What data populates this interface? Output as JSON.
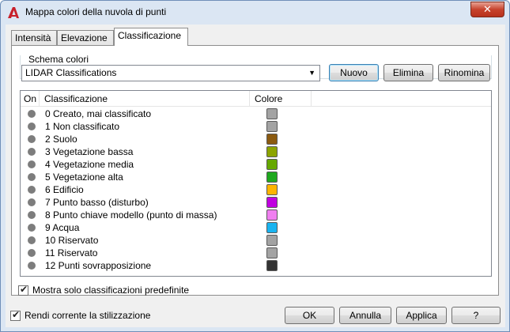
{
  "window": {
    "title": "Mappa colori della nuvola di punti",
    "close_glyph": "✕"
  },
  "tabs": [
    {
      "label": "Intensità",
      "mnemonic_index": 0
    },
    {
      "label": "Elevazione",
      "mnemonic_index": 0
    },
    {
      "label": "Classificazione",
      "mnemonic_index": 3
    }
  ],
  "active_tab": "Classificazione",
  "scheme": {
    "group_label": "Schema colori",
    "selected": "LIDAR Classifications",
    "buttons": {
      "new": "Nuovo",
      "delete": "Elimina",
      "rename": "Rinomina"
    }
  },
  "table": {
    "columns": [
      "On",
      "Classificazione",
      "Colore"
    ],
    "rows": [
      {
        "label": "0 Creato, mai classificato",
        "color": "#a3a3a3"
      },
      {
        "label": "1 Non classificato",
        "color": "#a3a3a3"
      },
      {
        "label": "2 Suolo",
        "color": "#8b5a10"
      },
      {
        "label": "3 Vegetazione bassa",
        "color": "#8ca400"
      },
      {
        "label": "4 Vegetazione media",
        "color": "#66a800"
      },
      {
        "label": "5 Vegetazione alta",
        "color": "#1ea81e"
      },
      {
        "label": "6 Edificio",
        "color": "#fdb400"
      },
      {
        "label": "7 Punto basso (disturbo)",
        "color": "#c000e0"
      },
      {
        "label": "8 Punto chiave modello (punto di massa)",
        "color": "#f07ff0"
      },
      {
        "label": "9 Acqua",
        "color": "#1ab4f0"
      },
      {
        "label": "10 Riservato",
        "color": "#a3a3a3"
      },
      {
        "label": "11 Riservato",
        "color": "#a3a3a3"
      },
      {
        "label": "12 Punti sovrapposizione",
        "color": "#333333"
      }
    ]
  },
  "show_predefined": {
    "label": "Mostra solo classificazioni predefinite",
    "checked": true
  },
  "make_current": {
    "label": "Rendi corrente la stilizzazione",
    "checked": true
  },
  "footer_buttons": {
    "ok": "OK",
    "cancel": "Annulla",
    "apply": "Applica",
    "help": "?"
  },
  "colors": {
    "title_bar": "#dbe6f3",
    "close_button": "#c7432d",
    "app_icon": "#c8202a"
  }
}
